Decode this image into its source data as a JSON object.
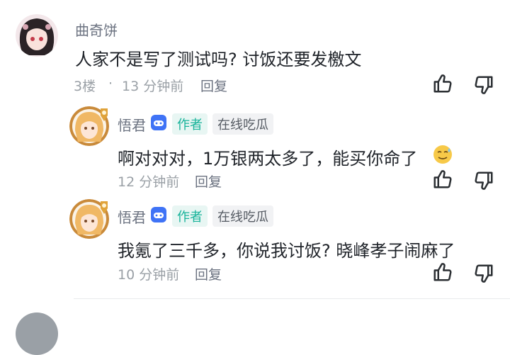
{
  "comment": {
    "username": "曲奇饼",
    "text": "人家不是写了测试吗? 讨饭还要发檄文",
    "floor": "3楼",
    "separator": "·",
    "time": "13 分钟前",
    "reply_label": "回复"
  },
  "replies": [
    {
      "username": "悟君",
      "author_badge": "作者",
      "tag": "在线吃瓜",
      "text": "啊对对对，1万银两太多了，能买你命了",
      "time": "12 分钟前",
      "reply_label": "回复"
    },
    {
      "username": "悟君",
      "author_badge": "作者",
      "tag": "在线吃瓜",
      "text": "我氪了三千多，你说我讨饭? 晓峰孝子闹麻了",
      "time": "10 分钟前",
      "reply_label": "回复"
    }
  ],
  "colors": {
    "accent": "#18b39a",
    "level_badge": "#3f73f6",
    "emoji": "#f7c948"
  }
}
